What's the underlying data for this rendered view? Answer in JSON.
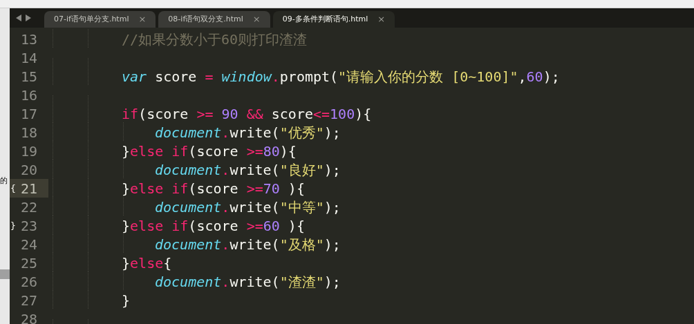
{
  "side_text": "的",
  "tabs": [
    {
      "label": "07-if语句单分支.html",
      "close": "×",
      "selected": false
    },
    {
      "label": "08-if语句双分支.html",
      "close": "×",
      "selected": false
    },
    {
      "label": "09-多条件判断语句.html",
      "close": "×",
      "selected": true
    }
  ],
  "lines": [
    {
      "number": "13",
      "current": false,
      "kind": "outer",
      "tokens": [
        {
          "kind": "comment",
          "text": "//如果分数小于60则打印渣渣"
        }
      ]
    },
    {
      "number": "14",
      "current": false,
      "kind": "blank"
    },
    {
      "number": "15",
      "current": false,
      "kind": "outer",
      "tokens": [
        {
          "kind": "storage",
          "text": "var"
        },
        {
          "kind": "plain",
          "text": " score "
        },
        {
          "kind": "operator",
          "text": "="
        },
        {
          "kind": "storage",
          "text": " window"
        },
        {
          "kind": "operator",
          "text": "."
        },
        {
          "kind": "plain",
          "text": "prompt("
        },
        {
          "kind": "string",
          "text": "\"请输入你的分数 [0~100]\""
        },
        {
          "kind": "plain",
          "text": ","
        },
        {
          "kind": "number",
          "text": "60"
        },
        {
          "kind": "plain",
          "text": ");"
        }
      ]
    },
    {
      "number": "16",
      "current": false,
      "kind": "blank"
    },
    {
      "number": "17",
      "current": false,
      "kind": "outer",
      "tokens": [
        {
          "kind": "keyword",
          "text": "if"
        },
        {
          "kind": "plain",
          "text": "(score "
        },
        {
          "kind": "operator",
          "text": ">="
        },
        {
          "kind": "number",
          "text": " 90"
        },
        {
          "kind": "operator",
          "text": " &&"
        },
        {
          "kind": "plain",
          "text": " score"
        },
        {
          "kind": "operator",
          "text": "<="
        },
        {
          "kind": "number",
          "text": "100"
        },
        {
          "kind": "plain",
          "text": "){"
        }
      ]
    },
    {
      "number": "18",
      "current": false,
      "kind": "inner",
      "tokens": [
        {
          "kind": "storage",
          "text": "document"
        },
        {
          "kind": "operator",
          "text": "."
        },
        {
          "kind": "plain",
          "text": "write("
        },
        {
          "kind": "string",
          "text": "\"优秀\""
        },
        {
          "kind": "plain",
          "text": ");"
        }
      ]
    },
    {
      "number": "19",
      "current": false,
      "kind": "outer",
      "tokens": [
        {
          "kind": "plain",
          "text": "}"
        },
        {
          "kind": "keyword",
          "text": "else if"
        },
        {
          "kind": "plain",
          "text": "(score "
        },
        {
          "kind": "operator",
          "text": ">="
        },
        {
          "kind": "number",
          "text": "80"
        },
        {
          "kind": "plain",
          "text": "){"
        }
      ]
    },
    {
      "number": "20",
      "current": false,
      "kind": "inner",
      "tokens": [
        {
          "kind": "storage",
          "text": "document"
        },
        {
          "kind": "operator",
          "text": "."
        },
        {
          "kind": "plain",
          "text": "write("
        },
        {
          "kind": "string",
          "text": "\"良好\""
        },
        {
          "kind": "plain",
          "text": ");"
        }
      ]
    },
    {
      "number": "21",
      "current": true,
      "marker": "{",
      "kind": "outer",
      "tokens": [
        {
          "kind": "plain",
          "text": "}"
        },
        {
          "kind": "keyword",
          "text": "else if"
        },
        {
          "kind": "plain",
          "text": "(score "
        },
        {
          "kind": "operator",
          "text": ">="
        },
        {
          "kind": "number",
          "text": "70"
        },
        {
          "kind": "plain",
          "text": " ){"
        }
      ]
    },
    {
      "number": "22",
      "current": false,
      "kind": "inner",
      "tokens": [
        {
          "kind": "storage",
          "text": "document"
        },
        {
          "kind": "operator",
          "text": "."
        },
        {
          "kind": "plain",
          "text": "write("
        },
        {
          "kind": "string",
          "text": "\"中等\""
        },
        {
          "kind": "plain",
          "text": ");"
        }
      ]
    },
    {
      "number": "23",
      "current": false,
      "marker": "}",
      "kind": "outer",
      "tokens": [
        {
          "kind": "plain",
          "text": "}"
        },
        {
          "kind": "keyword",
          "text": "else if"
        },
        {
          "kind": "plain",
          "text": "(score "
        },
        {
          "kind": "operator",
          "text": ">="
        },
        {
          "kind": "number",
          "text": "60"
        },
        {
          "kind": "plain",
          "text": " ){"
        }
      ]
    },
    {
      "number": "24",
      "current": false,
      "kind": "inner",
      "tokens": [
        {
          "kind": "storage",
          "text": "document"
        },
        {
          "kind": "operator",
          "text": "."
        },
        {
          "kind": "plain",
          "text": "write("
        },
        {
          "kind": "string",
          "text": "\"及格\""
        },
        {
          "kind": "plain",
          "text": ");"
        }
      ]
    },
    {
      "number": "25",
      "current": false,
      "kind": "outer",
      "tokens": [
        {
          "kind": "plain",
          "text": "}"
        },
        {
          "kind": "keyword",
          "text": "else"
        },
        {
          "kind": "plain",
          "text": "{"
        }
      ]
    },
    {
      "number": "26",
      "current": false,
      "kind": "inner",
      "tokens": [
        {
          "kind": "storage",
          "text": "document"
        },
        {
          "kind": "operator",
          "text": "."
        },
        {
          "kind": "plain",
          "text": "write("
        },
        {
          "kind": "string",
          "text": "\"渣渣\""
        },
        {
          "kind": "plain",
          "text": ");"
        }
      ]
    },
    {
      "number": "27",
      "current": false,
      "kind": "outer",
      "tokens": [
        {
          "kind": "plain",
          "text": "}"
        }
      ]
    },
    {
      "number": "28",
      "current": false,
      "kind": "blank"
    }
  ]
}
